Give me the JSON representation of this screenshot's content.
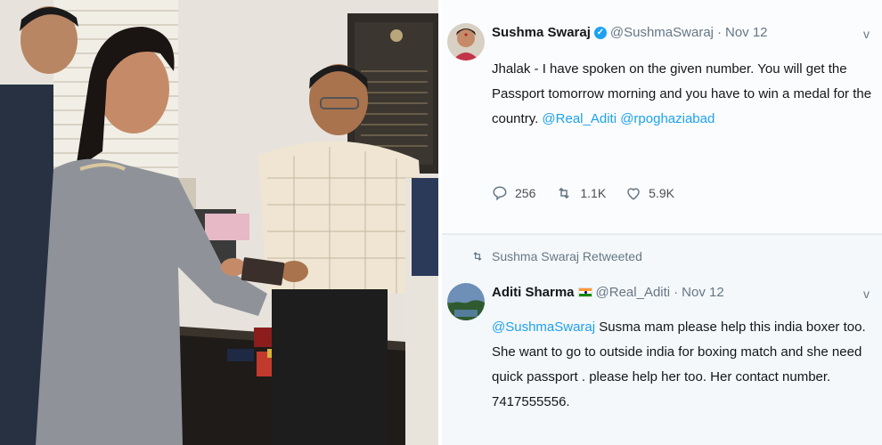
{
  "tweet1": {
    "author_name": "Sushma Swaraj",
    "handle": "@SushmaSwaraj",
    "dot": "·",
    "date": "Nov 12",
    "text": "Jhalak - I have spoken on the given number. You will get the Passport tomorrow morning and you have to win a medal for the country.",
    "mention1": "@Real_Aditi",
    "mention2": "@rpoghaziabad",
    "replies": "256",
    "retweets": "1.1K",
    "likes": "5.9K",
    "caret": "v"
  },
  "retweet_notice": "Sushma Swaraj Retweeted",
  "tweet2": {
    "author_name": "Aditi Sharma",
    "handle": "@Real_Aditi",
    "dot": "·",
    "date": "Nov 12",
    "mention": "@SushmaSwaraj",
    "text": "Susma mam please help this india boxer too. She want to go to outside india for boxing match and she need quick passport . please help her too. Her contact number. 7417555556.",
    "caret": "v"
  },
  "colors": {
    "link": "#1da1f2",
    "verified": "#1da1f2",
    "muted": "#657786"
  },
  "icons": [
    "verified-badge-icon",
    "india-flag-icon",
    "reply-icon",
    "retweet-icon",
    "like-icon",
    "chevron-down-icon"
  ]
}
